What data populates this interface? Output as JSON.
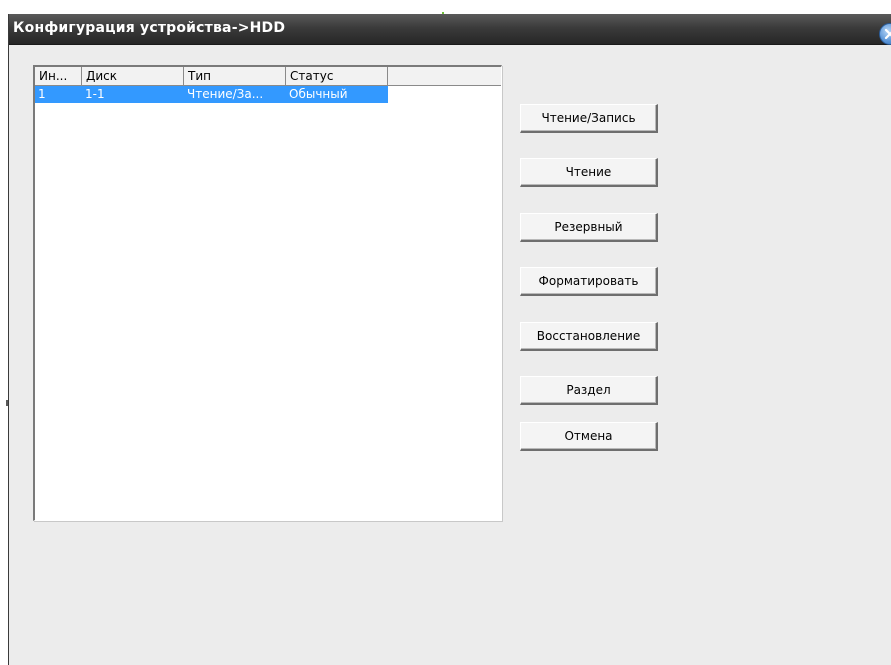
{
  "window": {
    "title": "Конфигурация устройства->HDD"
  },
  "disk_list": {
    "columns": [
      "Ин...",
      "Диск",
      "Тип",
      "Статус"
    ],
    "rows": [
      {
        "index": "1",
        "disk": "1-1",
        "type": "Чтение/За...",
        "status": "Обычный",
        "selected": true
      }
    ]
  },
  "buttons": {
    "read_write": "Чтение/Запись",
    "read_only": "Чтение",
    "redundant": "Резервный",
    "format": "Форматировать",
    "recover": "Восстановление",
    "partition": "Раздел",
    "cancel": "Отмена"
  },
  "colors": {
    "titlebar": "#2f2f2f",
    "window_bg": "#ececec",
    "selection": "#3399ff",
    "close_button": "#5d97d9"
  },
  "icons": {
    "close": "close-icon"
  }
}
